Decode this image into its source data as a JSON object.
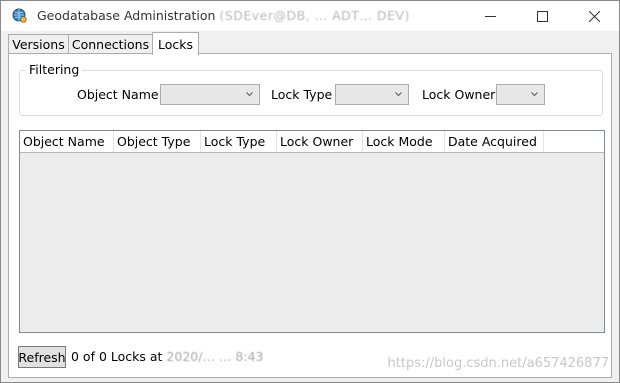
{
  "window": {
    "title": "Geodatabase Administration",
    "title_obscured": "(SDEver@DB, … ADT… DEV)",
    "icon": "geodatabase-globe-icon"
  },
  "controls": {
    "minimize": "minimize-icon",
    "maximize": "maximize-icon",
    "close": "close-icon"
  },
  "tabs": [
    {
      "label": "Versions",
      "active": false
    },
    {
      "label": "Connections",
      "active": false
    },
    {
      "label": "Locks",
      "active": true
    }
  ],
  "filtering": {
    "legend": "Filtering",
    "object_name_label": "Object Name",
    "object_name_value": "",
    "lock_type_label": "Lock Type",
    "lock_type_value": "",
    "lock_owner_label": "Lock Owner",
    "lock_owner_value": ""
  },
  "grid": {
    "columns": [
      "Object Name",
      "Object Type",
      "Lock Type",
      "Lock Owner",
      "Lock Mode",
      "Date Acquired"
    ],
    "rows": []
  },
  "footer": {
    "refresh_label": "Refresh",
    "status_text": "0 of 0 Locks at",
    "status_obscured": "2020/… … 8:43"
  },
  "watermark": "https://blog.csdn.net/a657426877",
  "colors": {
    "window_bg": "#f0f0f0",
    "panel_bg": "#ffffff",
    "grid_bg": "#ececec",
    "accent": "#1e6fb4"
  }
}
